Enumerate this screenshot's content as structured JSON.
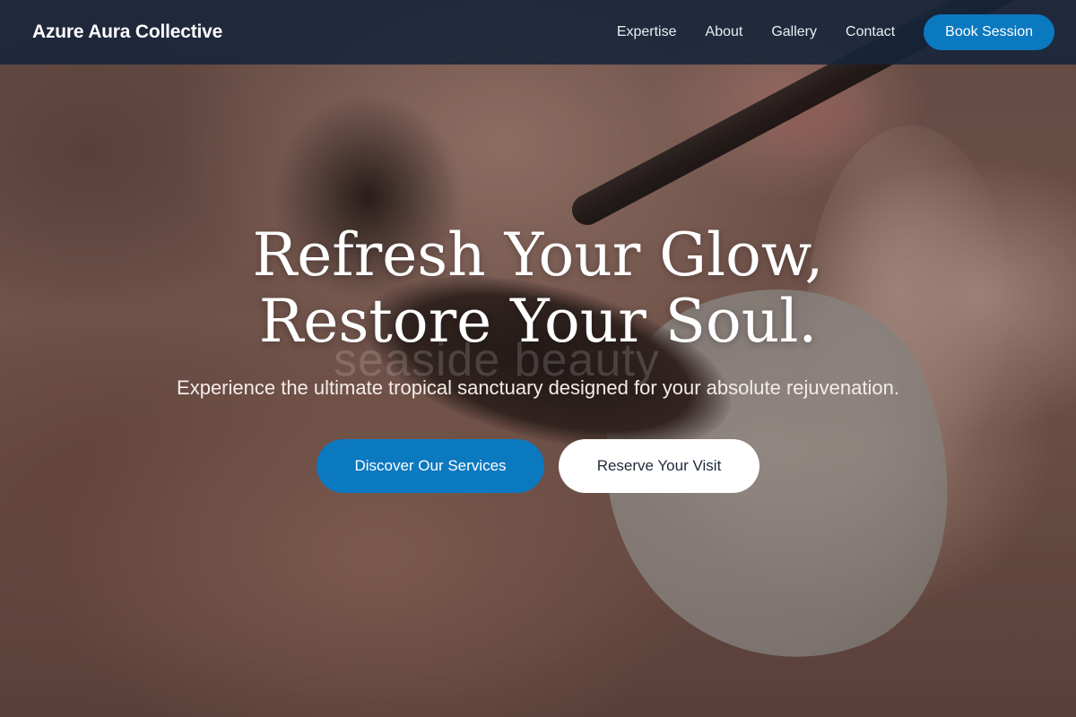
{
  "brand": {
    "name": "Azure Aura Collective"
  },
  "nav": {
    "links": [
      {
        "label": "Expertise"
      },
      {
        "label": "About"
      },
      {
        "label": "Gallery"
      },
      {
        "label": "Contact"
      }
    ],
    "cta_label": "Book Session"
  },
  "hero": {
    "headline_line1": "Refresh Your Glow,",
    "headline_line2": "Restore Your Soul.",
    "subheadline": "Experience the ultimate tropical sanctuary designed for your absolute rejuvenation.",
    "background_watermark": "seaside beauty",
    "primary_button": "Discover Our Services",
    "secondary_button": "Reserve Your Visit"
  },
  "colors": {
    "accent": "#0b79c0",
    "navbar": "#16243a",
    "button_text_dark": "#1f2a3a"
  }
}
